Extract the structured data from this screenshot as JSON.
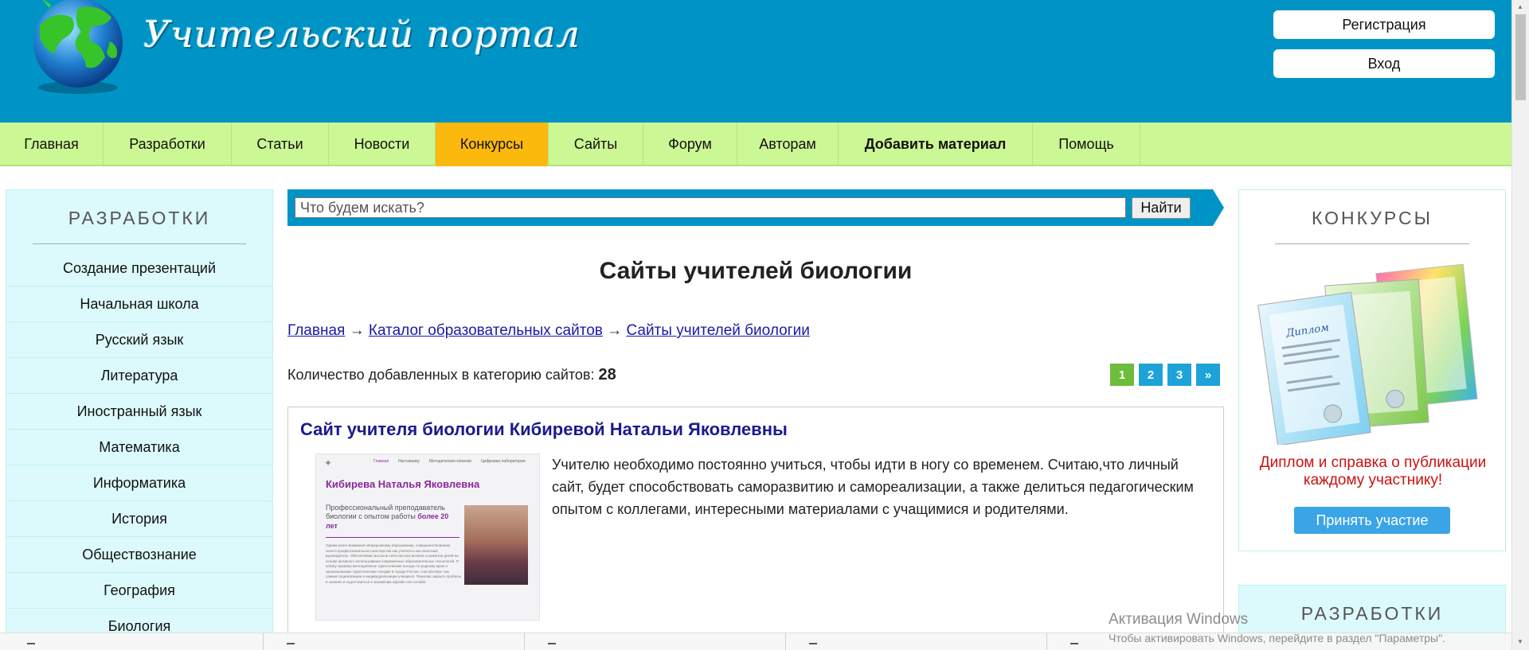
{
  "header": {
    "logo_text": "Учительский портал",
    "register_label": "Регистрация",
    "login_label": "Вход"
  },
  "nav": {
    "items": [
      {
        "label": "Главная",
        "active": false,
        "bold": false
      },
      {
        "label": "Разработки",
        "active": false,
        "bold": false
      },
      {
        "label": "Статьи",
        "active": false,
        "bold": false
      },
      {
        "label": "Новости",
        "active": false,
        "bold": false
      },
      {
        "label": "Конкурсы",
        "active": true,
        "bold": false
      },
      {
        "label": "Сайты",
        "active": false,
        "bold": false
      },
      {
        "label": "Форум",
        "active": false,
        "bold": false
      },
      {
        "label": "Авторам",
        "active": false,
        "bold": false
      },
      {
        "label": "Добавить материал",
        "active": false,
        "bold": true
      },
      {
        "label": "Помощь",
        "active": false,
        "bold": false
      }
    ]
  },
  "left_sidebar": {
    "title": "РАЗРАБОТКИ",
    "items": [
      "Создание презентаций",
      "Начальная школа",
      "Русский язык",
      "Литература",
      "Иностранный язык",
      "Математика",
      "Информатика",
      "История",
      "Обществознание",
      "География",
      "Биология"
    ]
  },
  "search": {
    "placeholder": "Что будем искать?",
    "button_label": "Найти"
  },
  "main": {
    "title": "Сайты учителей биологии",
    "breadcrumb": {
      "home": "Главная",
      "catalog": "Каталог образовательных сайтов",
      "current": "Сайты учителей биологии",
      "separator": "→"
    },
    "count_label": "Количество добавленных в категорию сайтов:",
    "count_value": "28",
    "pagination": {
      "pages": [
        "1",
        "2",
        "3"
      ],
      "current": "1",
      "next": "»"
    },
    "card": {
      "title": "Сайт учителя биологии Кибиревой Натальи Яковлевны",
      "description": "Учителю необходимо постоянно учиться, чтобы идти в ногу со временем. Считаю,что личный сайт, будет способствовать саморазвитию и самореализации, а также делиться педагогическим опытом с коллегами, интересными материалами с учащимися и родителями.",
      "thumbnail": {
        "nav": [
          "Главная",
          "Наставнику",
          "Методические копилки",
          "Цифровая лаборатория"
        ],
        "name": "Кибирева Наталья Яковлевна",
        "subtitle": "Профессиональный преподаватель биологии",
        "subtitle2": "с опытом работы",
        "highlight": "более 20 лет",
        "body_text": "Одним моего внимания непрерывному образованию, совершенствованию своего профессионального мастерства как учителя и как классный руководитель. Обеспечиваю высокое качество воспитания и развития детей на основе активного использования современных образовательных технологий. Я activity провожу многодневные туристические походы по родному краю и организовываю туристические поездки в города России, способствую там самым социализации и индивидуализации учащихся. Помогаю закрыть пробелы в знаниях и подготовиться к экзаменам офлайн или онлайн."
      }
    }
  },
  "right_sidebar": {
    "title": "КОНКУРСЫ",
    "promo_text": "Диплом и справка о публикации каждому участнику!",
    "button_label": "Принять участие",
    "diploma_label": "Диплом",
    "title2": "РАЗРАБОТКИ"
  },
  "watermark": {
    "title": "Активация Windows",
    "subtitle": "Чтобы активировать Windows, перейдите в раздел \"Параметры\"."
  },
  "colors": {
    "header_bg": "#0094c6",
    "nav_bg": "#ccf795",
    "nav_active": "#fbb80d",
    "sidebar_bg": "#dcfafc",
    "link": "#1a1aa6",
    "card_title": "#1a1a8c",
    "promo": "#cc1111",
    "button_blue": "#3aa5e6",
    "page_current": "#6bbd3a",
    "page_other": "#1ea3d9"
  }
}
